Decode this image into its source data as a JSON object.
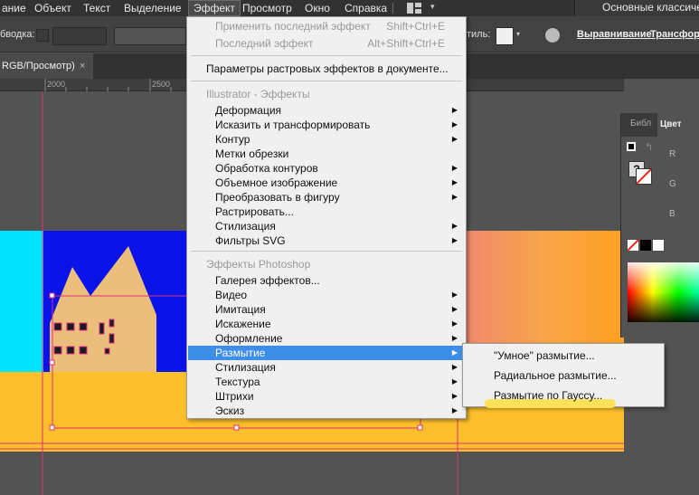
{
  "menubar": {
    "items": [
      "ание",
      "Объект",
      "Текст",
      "Выделение",
      "Эффект",
      "Просмотр",
      "Окно",
      "Справка"
    ],
    "workspace": "Основные классиче"
  },
  "controlbar": {
    "stroke_label": "бводка:",
    "style_label": "тиль:",
    "align_link": "Выравнивание",
    "transform_link": "Трансформ"
  },
  "document_tab": {
    "title": "RGB/Просмотр)",
    "close": "×"
  },
  "ruler": {
    "labels": [
      "2000",
      "2500"
    ]
  },
  "panel": {
    "tab_library": "Библ",
    "tab_color": "Цвет",
    "channels": [
      "R",
      "G",
      "B"
    ],
    "question": "?"
  },
  "effect_menu": {
    "items": [
      {
        "label": "Применить последний эффект",
        "shortcut": "Shift+Ctrl+E",
        "disabled": true
      },
      {
        "label": "Последний эффект",
        "shortcut": "Alt+Shift+Ctrl+E",
        "disabled": true
      },
      {
        "label": "Параметры растровых эффектов в документе..."
      },
      {
        "label": "Illustrator - Эффекты",
        "header": true
      },
      {
        "label": "Деформация",
        "submenu": true
      },
      {
        "label": "Исказить и трансформировать",
        "submenu": true
      },
      {
        "label": "Контур",
        "submenu": true
      },
      {
        "label": "Метки обрезки"
      },
      {
        "label": "Обработка контуров",
        "submenu": true
      },
      {
        "label": "Объемное изображение",
        "submenu": true
      },
      {
        "label": "Преобразовать в фигуру",
        "submenu": true
      },
      {
        "label": "Растрировать..."
      },
      {
        "label": "Стилизация",
        "submenu": true
      },
      {
        "label": "Фильтры SVG",
        "submenu": true
      },
      {
        "label": "Эффекты Photoshop",
        "header": true
      },
      {
        "label": "Галерея эффектов..."
      },
      {
        "label": "Видео",
        "submenu": true
      },
      {
        "label": "Имитация",
        "submenu": true
      },
      {
        "label": "Искажение",
        "submenu": true
      },
      {
        "label": "Оформление",
        "submenu": true
      },
      {
        "label": "Размытие",
        "submenu": true,
        "highlighted": true
      },
      {
        "label": "Стилизация",
        "submenu": true
      },
      {
        "label": "Текстура",
        "submenu": true
      },
      {
        "label": "Штрихи",
        "submenu": true
      },
      {
        "label": "Эскиз",
        "submenu": true
      }
    ]
  },
  "blur_submenu": {
    "items": [
      "\"Умное\" размытие...",
      "Радиальное размытие...",
      "Размытие по Гауссу..."
    ]
  },
  "colors": {
    "accent": "#3d8ee9",
    "highlight_marker": "#fde15a",
    "cyan": "#00e5ff",
    "blue": "#0a14e8",
    "house": "#ecbe7c",
    "yellow": "#fdbf2a",
    "guide": "#e0307a"
  }
}
